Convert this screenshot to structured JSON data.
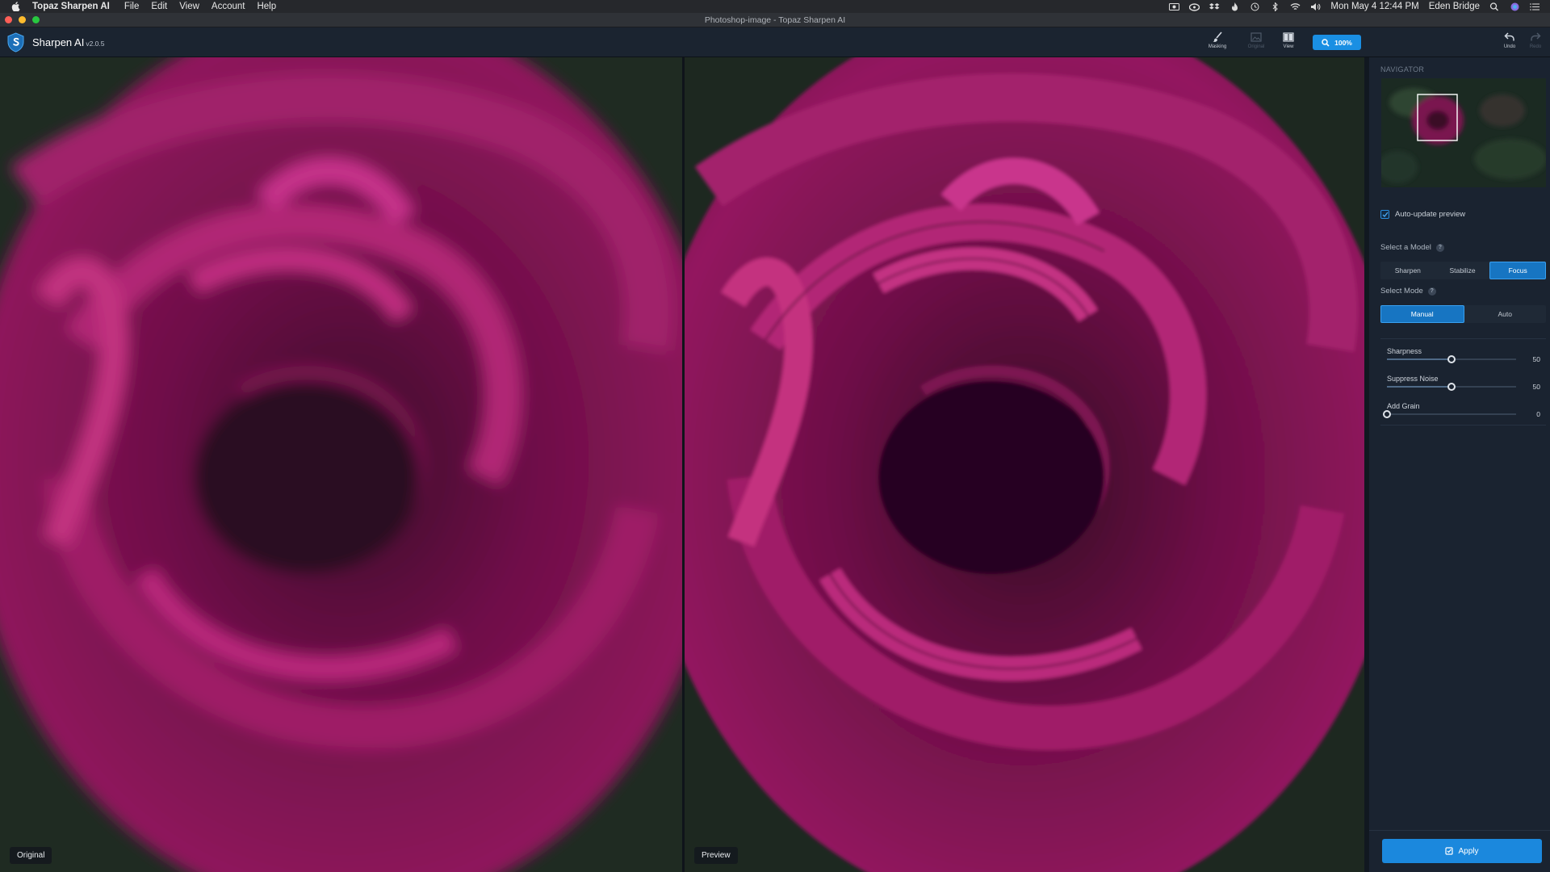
{
  "menubar": {
    "app_name": "Topaz Sharpen AI",
    "items": [
      "File",
      "Edit",
      "View",
      "Account",
      "Help"
    ],
    "clock": "Mon May 4  12:44 PM",
    "user": "Eden Bridge"
  },
  "window": {
    "title": "Photoshop-image - Topaz Sharpen AI"
  },
  "toolbar": {
    "app_title": "Sharpen AI",
    "version": "v2.0.5",
    "masking_label": "Masking",
    "original_label": "Original",
    "view_label": "View",
    "zoom_label": "100%",
    "undo_label": "Undo",
    "redo_label": "Redo"
  },
  "panes": {
    "left_label": "Original",
    "right_label": "Preview"
  },
  "sidebar": {
    "navigator_title": "NAVIGATOR",
    "auto_update_label": "Auto-update preview",
    "auto_update_checked": true,
    "model_label": "Select a Model",
    "models": [
      "Sharpen",
      "Stabilize",
      "Focus"
    ],
    "selected_model": "Focus",
    "mode_label": "Select Mode",
    "modes": [
      "Manual",
      "Auto"
    ],
    "selected_mode": "Manual",
    "sliders": [
      {
        "name": "Sharpness",
        "value": "50",
        "fraction": 0.5
      },
      {
        "name": "Suppress Noise",
        "value": "50",
        "fraction": 0.5
      },
      {
        "name": "Add Grain",
        "value": "0",
        "fraction": 0.0
      }
    ],
    "apply_label": "Apply"
  },
  "colors": {
    "accent": "#1b88dd",
    "rose": "#8a1457",
    "background": "#1a2330"
  }
}
